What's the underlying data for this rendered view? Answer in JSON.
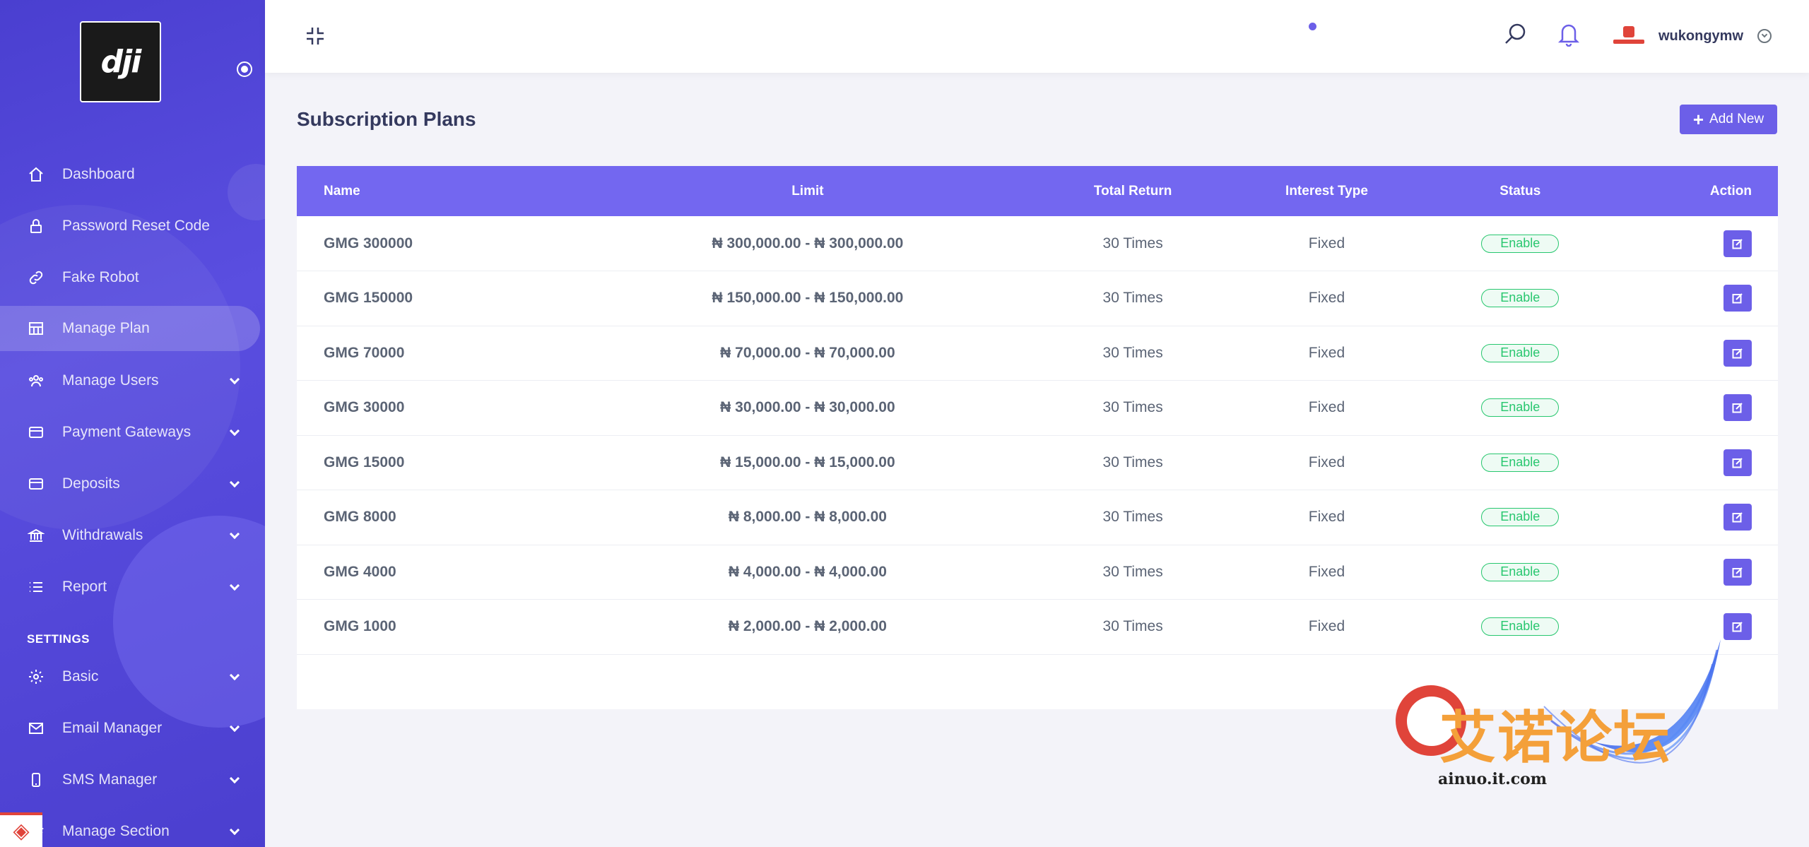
{
  "brand": {
    "logo_text": "dji"
  },
  "sidebar": {
    "items": [
      {
        "label": "Dashboard",
        "icon": "home-icon",
        "has_submenu": false
      },
      {
        "label": "Password Reset Code",
        "icon": "lock-icon",
        "has_submenu": false
      },
      {
        "label": "Fake Robot",
        "icon": "link-icon",
        "has_submenu": false
      },
      {
        "label": "Manage Plan",
        "icon": "grid-icon",
        "has_submenu": false,
        "active": true
      },
      {
        "label": "Manage Users",
        "icon": "users-icon",
        "has_submenu": true
      },
      {
        "label": "Payment Gateways",
        "icon": "credit-card-icon",
        "has_submenu": true
      },
      {
        "label": "Deposits",
        "icon": "credit-card-icon",
        "has_submenu": true
      },
      {
        "label": "Withdrawals",
        "icon": "bank-icon",
        "has_submenu": true
      },
      {
        "label": "Report",
        "icon": "list-icon",
        "has_submenu": true
      }
    ],
    "settings_heading": "SETTINGS",
    "settings_items": [
      {
        "label": "Basic",
        "icon": "gear-icon",
        "has_submenu": true
      },
      {
        "label": "Email Manager",
        "icon": "mail-icon",
        "has_submenu": true
      },
      {
        "label": "SMS Manager",
        "icon": "mobile-icon",
        "has_submenu": true
      },
      {
        "label": "Manage Section",
        "icon": "layers-icon",
        "has_submenu": true
      }
    ]
  },
  "topbar": {
    "username": "wukongymw",
    "avatar_icon": "user-avatar-icon"
  },
  "main": {
    "title": "Subscription Plans",
    "add_new_label": "Add New",
    "table": {
      "headers": {
        "name": "Name",
        "limit": "Limit",
        "total_return": "Total Return",
        "interest_type": "Interest Type",
        "status": "Status",
        "action": "Action"
      },
      "rows": [
        {
          "name": "GMG 300000",
          "limit": "₦ 300,000.00 - ₦ 300,000.00",
          "total_return": "30 Times",
          "interest_type": "Fixed",
          "status": "Enable"
        },
        {
          "name": "GMG 150000",
          "limit": "₦ 150,000.00 - ₦ 150,000.00",
          "total_return": "30 Times",
          "interest_type": "Fixed",
          "status": "Enable"
        },
        {
          "name": "GMG 70000",
          "limit": "₦ 70,000.00 - ₦ 70,000.00",
          "total_return": "30 Times",
          "interest_type": "Fixed",
          "status": "Enable"
        },
        {
          "name": "GMG 30000",
          "limit": "₦ 30,000.00 - ₦ 30,000.00",
          "total_return": "30 Times",
          "interest_type": "Fixed",
          "status": "Enable"
        },
        {
          "name": "GMG 15000",
          "limit": "₦ 15,000.00 - ₦ 15,000.00",
          "total_return": "30 Times",
          "interest_type": "Fixed",
          "status": "Enable"
        },
        {
          "name": "GMG 8000",
          "limit": "₦ 8,000.00 - ₦ 8,000.00",
          "total_return": "30 Times",
          "interest_type": "Fixed",
          "status": "Enable"
        },
        {
          "name": "GMG 4000",
          "limit": "₦ 4,000.00 - ₦ 4,000.00",
          "total_return": "30 Times",
          "interest_type": "Fixed",
          "status": "Enable"
        },
        {
          "name": "GMG 1000",
          "limit": "₦ 2,000.00 - ₦ 2,000.00",
          "total_return": "30 Times",
          "interest_type": "Fixed",
          "status": "Enable"
        }
      ]
    }
  },
  "watermark": {
    "text": "艾诺论坛",
    "url": "ainuo.it.com"
  },
  "colors": {
    "primary": "#6c5fe8",
    "sidebar": "#4a3fd0",
    "success": "#28c76f"
  }
}
